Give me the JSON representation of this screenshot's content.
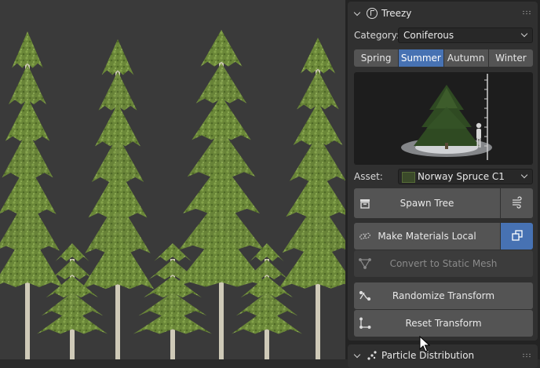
{
  "panel": {
    "title": "Treezy",
    "category_label": "Category:",
    "category_value": "Coniferous",
    "seasons": [
      {
        "label": "Spring",
        "active": false
      },
      {
        "label": "Summer",
        "active": true
      },
      {
        "label": "Autumn",
        "active": false
      },
      {
        "label": "Winter",
        "active": false
      }
    ],
    "asset_label": "Asset:",
    "asset_value": "Norway Spruce C1",
    "buttons": {
      "spawn": "Spawn Tree",
      "make_local": "Make Materials Local",
      "convert": "Convert to Static Mesh",
      "randomize": "Randomize Transform",
      "reset": "Reset Transform"
    },
    "next_section_title": "Particle Distribution"
  },
  "colors": {
    "accent": "#4772b3",
    "panel_bg": "#303030",
    "button_bg": "#545454",
    "tree_foliage": "#6d8a3a",
    "trunk": "#cfcab8"
  },
  "icons": {
    "header": "treezy-logo-icon",
    "spawn": "archive-box-icon",
    "wind": "wind-icon",
    "make_local": "chain-link-icon",
    "duplicate": "duplicate-icon",
    "convert": "mesh-icon",
    "randomize": "randomize-icon",
    "reset": "axes-icon"
  }
}
